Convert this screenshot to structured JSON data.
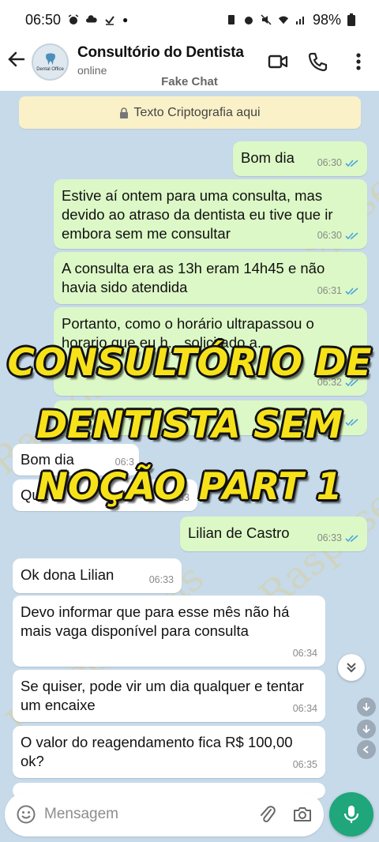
{
  "status_bar": {
    "time": "06:50",
    "battery": "98%"
  },
  "header": {
    "contact_name": "Consultório do Dentista",
    "contact_status": "online",
    "subtitle": "Fake Chat",
    "avatar_label": "Dental Office"
  },
  "encryption_notice": "Texto Criptografia aqui",
  "messages": [
    {
      "dir": "out",
      "text": "Bom dia",
      "time": "06:30"
    },
    {
      "dir": "out",
      "text": "Estive aí ontem para uma consulta, mas devido ao atraso da dentista eu tive que ir embora sem me consultar",
      "time": "06:30"
    },
    {
      "dir": "out",
      "text": "A consulta era as 13h eram 14h45 e não havia sido atendida",
      "time": "06:31"
    },
    {
      "dir": "out",
      "text": "Portanto, como o horário ultrapassou o horario que eu h... solicitado a...",
      "time": "06:32"
    },
    {
      "dir": "out",
      "text": "",
      "time": "06:32"
    },
    {
      "dir": "in",
      "text": "Bom dia",
      "time": "06:3"
    },
    {
      "dir": "in",
      "text": "Qua",
      "time": "06:33"
    },
    {
      "dir": "out",
      "text": "Lilian de Castro",
      "time": "06:33"
    },
    {
      "dir": "in",
      "text": "Ok dona Lilian",
      "time": "06:33"
    },
    {
      "dir": "in",
      "text": "Devo informar que para esse mês não há mais vaga disponível para consulta",
      "time": "06:34"
    },
    {
      "dir": "in",
      "text": "Se quiser, pode vir um dia qualquer e tentar um encaixe",
      "time": "06:34"
    },
    {
      "dir": "in",
      "text": "O valor do reagendamento fica R$ 100,00 ok?",
      "time": "06:35"
    }
  ],
  "overlay_caption": [
    "CONSULTÓRIO DE",
    "DENTISTA SEM",
    "NOÇÃO PART 1"
  ],
  "watermark": "Rasposentas",
  "input": {
    "placeholder": "Mensagem"
  },
  "colors": {
    "chat_bg": "#c7daea",
    "outgoing_bubble": "#dcf8c6",
    "incoming_bubble": "#ffffff",
    "accent": "#1fa67a",
    "caption_fill": "#f7e21a",
    "read_ticks": "#4fa3e0"
  }
}
